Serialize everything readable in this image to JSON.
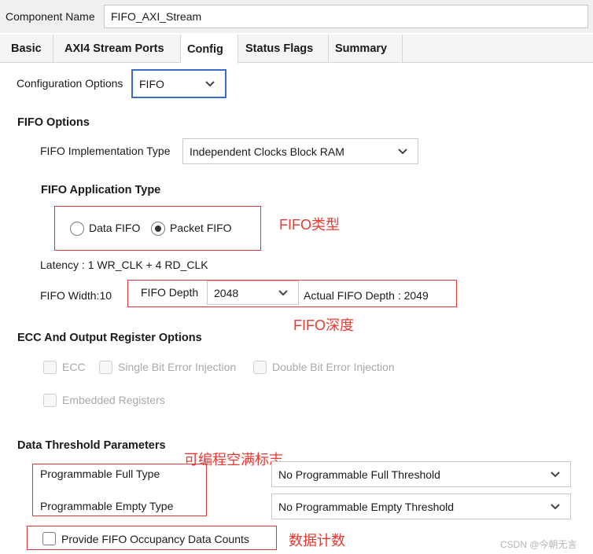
{
  "component": {
    "label": "Component Name",
    "value": "FIFO_AXI_Stream"
  },
  "tabs": [
    {
      "label": "Basic"
    },
    {
      "label": "AXI4 Stream Ports"
    },
    {
      "label": "Config"
    },
    {
      "label": "Status Flags"
    },
    {
      "label": "Summary"
    }
  ],
  "active_tab": "Config",
  "config_options": {
    "label": "Configuration Options",
    "value": "FIFO"
  },
  "fifo_options": {
    "heading": "FIFO Options",
    "impl_label": "FIFO Implementation Type",
    "impl_value": "Independent Clocks Block RAM",
    "app_type_heading": "FIFO Application Type",
    "radio_data": "Data FIFO",
    "radio_packet": "Packet FIFO",
    "selected": "Packet FIFO",
    "latency": "Latency : 1 WR_CLK + 4 RD_CLK",
    "width": "FIFO Width:10",
    "depth_label": "FIFO Depth",
    "depth_value": "2048",
    "actual_depth": "Actual FIFO Depth : 2049"
  },
  "ecc": {
    "heading": "ECC And Output Register Options",
    "ecc_label": "ECC",
    "single_bit": "Single Bit Error Injection",
    "double_bit": "Double Bit Error Injection",
    "embedded": "Embedded Registers"
  },
  "threshold": {
    "heading": "Data Threshold Parameters",
    "full_label": "Programmable Full Type",
    "full_value": "No Programmable Full Threshold",
    "empty_label": "Programmable Empty Type",
    "empty_value": "No Programmable Empty Threshold",
    "occupancy_label": "Provide FIFO Occupancy Data Counts",
    "occupancy_checked": false
  },
  "annotations": {
    "fifo_type": "FIFO类型",
    "fifo_depth": "FIFO深度",
    "prog_flags": "可编程空满标志",
    "data_count": "数据计数"
  },
  "watermark": "CSDN @今朝无言",
  "colors": {
    "annotation_red": "#e63a32",
    "focus_blue": "#3c6bd0",
    "tab_bar": "#f5f5f5"
  }
}
